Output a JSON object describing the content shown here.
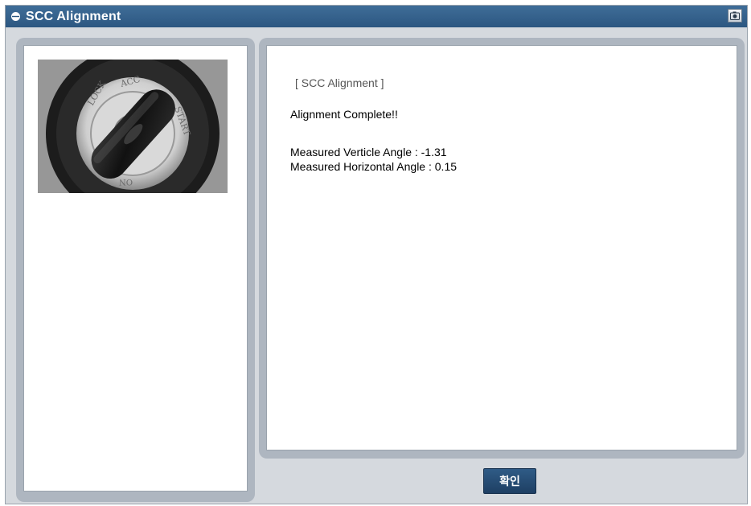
{
  "window": {
    "title": "SCC Alignment",
    "title_icon": "window-icon",
    "capture_icon": "camera-icon"
  },
  "message": {
    "header": "[ SCC Alignment ]",
    "status": "Alignment Complete!!",
    "vertical_label": "Measured Verticle Angle : -1.31",
    "horizontal_label": "Measured Horizontal Angle : 0.15"
  },
  "image": {
    "subject": "ignition-key-switch",
    "engraved_text": [
      "LOCK",
      "ACC",
      "START",
      "ON"
    ]
  },
  "buttons": {
    "confirm": "확인"
  },
  "colors": {
    "titlebar": "#2c5781",
    "panel_border": "#aeb6c0",
    "button": "#1e3f63"
  }
}
